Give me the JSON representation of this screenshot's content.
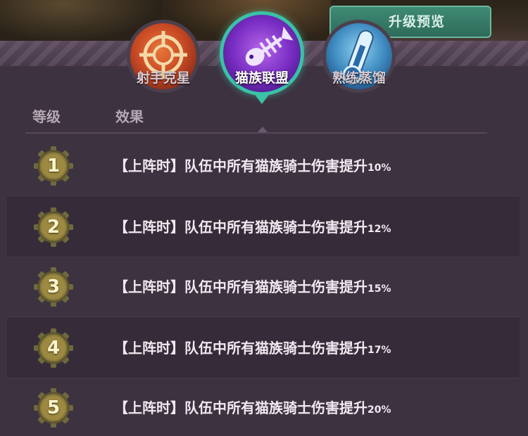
{
  "header": {
    "preview_button_label": "升级预览"
  },
  "tabs": [
    {
      "label": "射手克星",
      "icon": "crosshair-icon",
      "selected": false
    },
    {
      "label": "猫族联盟",
      "icon": "fishbone-icon",
      "selected": true
    },
    {
      "label": "熟练蒸馏",
      "icon": "thermometer-icon",
      "selected": false
    }
  ],
  "table": {
    "columns": [
      "等级",
      "效果"
    ],
    "rows": [
      {
        "level": "1",
        "effect": "【上阵时】队伍中所有猫族骑士伤害提升",
        "percent": "10%"
      },
      {
        "level": "2",
        "effect": "【上阵时】队伍中所有猫族骑士伤害提升",
        "percent": "12%"
      },
      {
        "level": "3",
        "effect": "【上阵时】队伍中所有猫族骑士伤害提升",
        "percent": "15%"
      },
      {
        "level": "4",
        "effect": "【上阵时】队伍中所有猫族骑士伤害提升",
        "percent": "17%"
      },
      {
        "level": "5",
        "effect": "【上阵时】队伍中所有猫族骑士伤害提升",
        "percent": "20%"
      }
    ]
  },
  "colors": {
    "panel": "#3d3240",
    "selected_ring": "#39c2a6",
    "badge_gold": "#8a7a3a",
    "text": "#f2e8f0"
  }
}
